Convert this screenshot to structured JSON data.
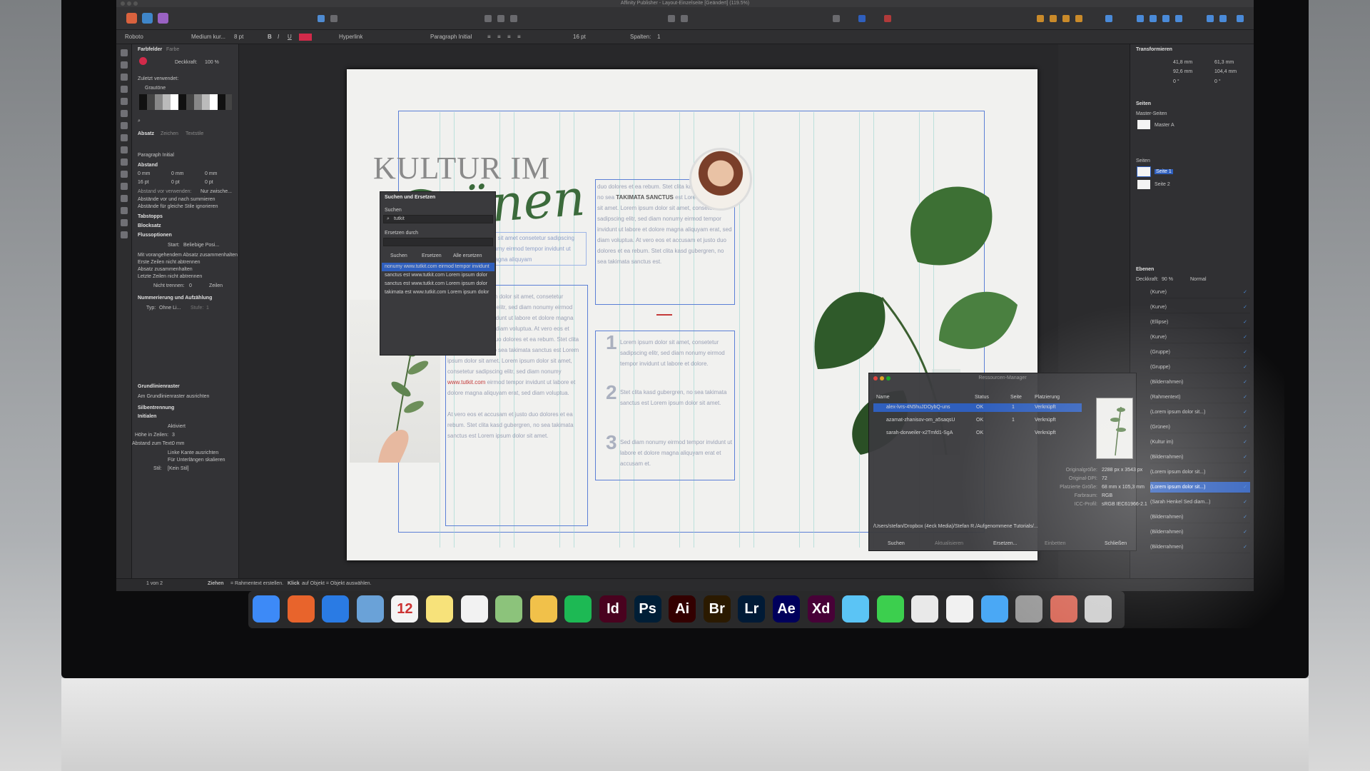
{
  "window": {
    "title": "Affinity Publisher - Layout-Einzelseite [Geändert] (119.5%)"
  },
  "toolbar2": {
    "font": "Roboto",
    "weight": "Medium kur...",
    "size": "8 pt",
    "hyperlink": "Hyperlink",
    "para_style": "Paragraph Initial",
    "leading": "16 pt",
    "columns_label": "Spalten:",
    "columns_value": "1"
  },
  "left_panel": {
    "tab1": "Farbfelder",
    "tab2": "Farbe",
    "opacity_label": "Deckkraft:",
    "opacity_value": "100 %",
    "recent_label": "Zuletzt verwendet:",
    "grays_label": "Grautöne",
    "tabs": [
      "Absatz",
      "Zeichen",
      "Textstile"
    ],
    "para_style": "Paragraph Initial",
    "abstand": "Abstand",
    "values": [
      "0 mm",
      "0 mm",
      "0 mm",
      "16 pt",
      "0 pt",
      "0 pt"
    ],
    "abstand_vor": "Abstand vor verwenden:",
    "abstand_vor_val": "Nur zwische...",
    "check1": "Abstände vor und nach summieren",
    "check2": "Abstände für gleiche Stile ignorieren",
    "tabstopps": "Tabstopps",
    "blocksatz": "Blocksatz",
    "fluss": "Flussoptionen",
    "start_label": "Start:",
    "start_value": "Beliebige Posi...",
    "flow": [
      "Mit vorangehendem Absatz zusammenhalten",
      "Erste Zeilen nicht abtrennen",
      "Absatz zusammenhalten",
      "Letzte Zeilen nicht abtrennen"
    ],
    "nicht_trennen": "Nicht trennen:",
    "nicht_trennen_val": "0",
    "zeilen": "Zeilen",
    "numbering": "Nummerierung und Aufzählung",
    "typ_label": "Typ:",
    "typ_value": "Ohne Li...",
    "stufe_label": "Stufe:",
    "stufe_value": "1",
    "grid": "Grundlinienraster",
    "grid_align": "Am Grundlinienraster ausrichten",
    "silben": "Silbentrennung",
    "initialen": "Initialen",
    "aktiviert": "Aktiviert",
    "hoehe_label": "Höhe in Zeilen:",
    "hoehe_value": "3",
    "abstand_text_label": "Abstand zum Text:",
    "abstand_text_value": "0 mm",
    "linke_kante": "Linke Kante ausrichten",
    "unterlaengen": "Für Unterlängen skalieren",
    "stil_label": "Stil:",
    "stil_value": "[Kein Stil]"
  },
  "find_panel": {
    "title": "Suchen und Ersetzen",
    "search_label": "Suchen",
    "search_value": "tutkit",
    "replace_label": "Ersetzen durch",
    "btn_find": "Suchen",
    "btn_replace": "Ersetzen",
    "btn_all": "Alle ersetzen",
    "results": [
      "nonumy www.tutkit.com eirmod tempor invidunt",
      "sanctus est www.tutkit.com Lorem ipsum dolor",
      "sanctus est www.tutkit.com Lorem ipsum dolor",
      "takimata est www.tutkit.com Lorem ipsum dolor"
    ]
  },
  "page": {
    "heading1": "KULTUR IM",
    "heading2": "Grünen",
    "intro": "Lorem ipsum dolor sit amet consetetur sadipscing elitr sed diam nonumy eirmod tempor invidunt ut labore et dolore magna aliquyam",
    "dropcap": "L",
    "body1": "orem ipsum dolor sit amet, consetetur sadipscing elitr, sed diam nonumy eirmod tempor invidunt ut labore et dolore magna aliquyam erat, sed diam voluptua. At vero eos et accusam et justo duo dolores et ea rebum. Stet clita kasd gubergren, no sea takimata sanctus est Lorem ipsum dolor sit amet. Lorem ipsum dolor sit amet, consetetur sadipscing elitr, sed diam nonumy",
    "link": "www.tutkit.com",
    "body1b": "eirmod tempor invidunt ut labore et dolore magna aliquyam erat, sed diam voluptua.",
    "body2": "At vero eos et accusam et justo duo dolores et ea rebum. Stet clita kasd gubergren, no sea takimata sanctus est Lorem ipsum dolor sit amet.",
    "col2_pre": "duo dolores et ea rebum. Stet clita kasd gubergren, no sea",
    "col2_bold": "TAKIMATA SANCTUS",
    "col2": "est Lorem ipsum dolor sit amet. Lorem ipsum dolor sit amet, consetetur sadipscing elitr, sed diam nonumy eirmod tempor invidunt ut labore et dolore magna aliquyam erat, sed diam voluptua. At vero eos et accusam et justo duo dolores et ea rebum. Stet clita kasd gubergren, no sea takimata sanctus est.",
    "items": [
      {
        "num": "1",
        "text": "Lorem ipsum dolor sit amet, consetetur sadipscing elitr, sed diam nonumy eirmod tempor invidunt ut labore et dolore."
      },
      {
        "num": "2",
        "text": "Stet clita kasd gubergren, no sea takimata sanctus est Lorem ipsum dolor sit amet."
      },
      {
        "num": "3",
        "text": "Sed diam nonumy eirmod tempor invidunt ut labore et dolore magna aliquyam erat et accusam et."
      }
    ]
  },
  "right_panel": {
    "transform": "Transformieren",
    "x": "41,8 mm",
    "y": "92,6 mm",
    "b": "61,3 mm",
    "h": "104,4 mm",
    "r": "0 °",
    "s": "0 °",
    "pages": "Seiten",
    "master_pages": "Master-Seiten",
    "master_a": "Master A",
    "pages_sub": "Seiten",
    "page1": "Seite 1",
    "page2": "Seite 2",
    "layers": "Ebenen",
    "opacity": "Deckkraft:",
    "opacity_value": "90 %",
    "blend": "Normal",
    "layer_items": [
      "(Kurve)",
      "(Kurve)",
      "(Ellipse)",
      "(Kurve)",
      "(Gruppe)",
      "(Gruppe)",
      "(Bilderrahmen)",
      "(Rahmentext)",
      "(Lorem ipsum dolor sit...)",
      "(Grünen)",
      "(Kultur im)",
      "(Bilderrahmen)",
      "(Lorem ipsum dolor sit...)",
      "(Lorem ipsum dolor sit...)",
      "(Sarah Henkel Sed diam...)",
      "(Bilderrahmen)",
      "(Bilderrahmen)",
      "(Bilderrahmen)"
    ]
  },
  "resources_dialog": {
    "title": "Ressourcen-Manager",
    "cols": [
      "Name",
      "Status",
      "Seite",
      "Platzierung"
    ],
    "rows": [
      {
        "name": "alex-lvrs-4N5huJDOybQ-uns",
        "status": "OK",
        "page": "1",
        "placement": "Verknüpft"
      },
      {
        "name": "azamat-zhanisov-om_a5saqsU",
        "status": "OK",
        "page": "1",
        "placement": "Verknüpft"
      },
      {
        "name": "sarah-dorweiler-x2Tmfd1-SgA",
        "status": "OK",
        "page": "",
        "placement": "Verknüpft"
      }
    ],
    "info": [
      {
        "label": "Originalgröße:",
        "value": "2288 px x 3543 px"
      },
      {
        "label": "Original-DPI:",
        "value": "72"
      },
      {
        "label": "Platzierte Größe:",
        "value": "68 mm x 105,3 mm"
      },
      {
        "label": "Farbraum:",
        "value": "RGB"
      },
      {
        "label": "ICC-Profil:",
        "value": "sRGB IEC61966-2.1"
      }
    ],
    "path": "/Users/stefan/Dropbox (4eck Media)/Stefan R./Aufgenommene Tutorials/...",
    "btn_find": "Suchen",
    "btn_update": "Aktualisieren",
    "btn_replace": "Ersetzen...",
    "btn_embed": "Einbetten",
    "btn_close": "Schließen"
  },
  "status": {
    "pages": "1 von 2",
    "hint_bold1": "Ziehen",
    "hint1": "= Rahmentext erstellen.",
    "hint_bold2": "Klick",
    "hint2": "auf Objekt = Objekt auswählen."
  },
  "dock": [
    {
      "label": "",
      "name": "finder-icon",
      "color": "#3d8af7"
    },
    {
      "label": "",
      "name": "firefox-icon",
      "color": "#e8642c"
    },
    {
      "label": "",
      "name": "safari-icon",
      "color": "#2a7be4"
    },
    {
      "label": "",
      "name": "preview-icon",
      "color": "#6aa2d8"
    },
    {
      "label": "12",
      "name": "calendar-icon",
      "color": "#f4f4f4"
    },
    {
      "label": "",
      "name": "notes-icon",
      "color": "#f7e27a"
    },
    {
      "label": "",
      "name": "reminders-icon",
      "color": "#f2f2f2"
    },
    {
      "label": "",
      "name": "maps-icon",
      "color": "#8cc37b"
    },
    {
      "label": "",
      "name": "photos-icon",
      "color": "#f1c14a"
    },
    {
      "label": "",
      "name": "spotify-icon",
      "color": "#1db954"
    },
    {
      "label": "Id",
      "name": "indesign-icon",
      "color": "#49021f"
    },
    {
      "label": "Ps",
      "name": "photoshop-icon",
      "color": "#001e36"
    },
    {
      "label": "Ai",
      "name": "illustrator-icon",
      "color": "#330000"
    },
    {
      "label": "Br",
      "name": "bridge-icon",
      "color": "#2b1a00"
    },
    {
      "label": "Lr",
      "name": "lightroom-icon",
      "color": "#001a36"
    },
    {
      "label": "Ae",
      "name": "aftereffects-icon",
      "color": "#00005b"
    },
    {
      "label": "Xd",
      "name": "xd-icon",
      "color": "#470137"
    },
    {
      "label": "",
      "name": "messages-icon",
      "color": "#5bc4f5"
    },
    {
      "label": "",
      "name": "facetime-icon",
      "color": "#3ccf4e"
    },
    {
      "label": "",
      "name": "slack-icon",
      "color": "#e9e9e9"
    },
    {
      "label": "",
      "name": "music-icon",
      "color": "#f1f1f1"
    },
    {
      "label": "",
      "name": "appstore-icon",
      "color": "#4aa8f5"
    },
    {
      "label": "",
      "name": "system-preferences-icon",
      "color": "#9a9a9a"
    },
    {
      "label": "",
      "name": "affinity-publisher-icon",
      "color": "#d86a5a"
    },
    {
      "label": "",
      "name": "trash-icon",
      "color": "#cfcfcf"
    }
  ]
}
